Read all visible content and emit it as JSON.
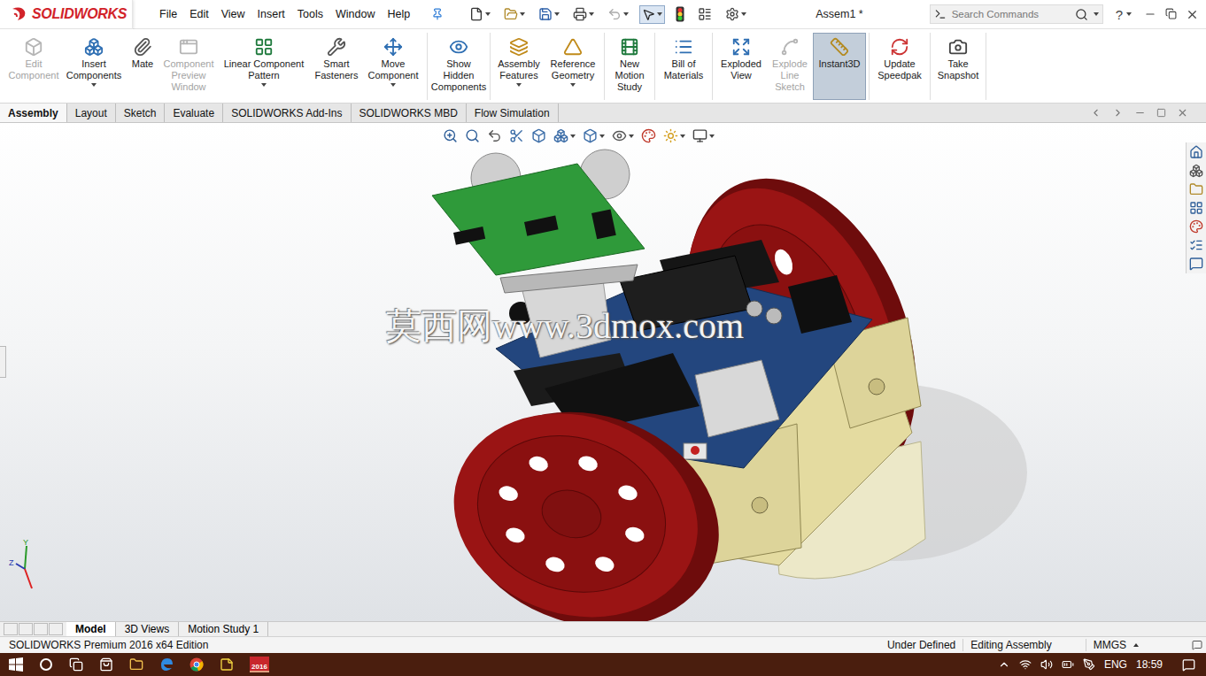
{
  "app": {
    "logo": "SOLIDWORKS"
  },
  "menu": [
    "File",
    "Edit",
    "View",
    "Insert",
    "Tools",
    "Window",
    "Help"
  ],
  "window": {
    "title": "Assem1 *"
  },
  "search": {
    "placeholder": "Search Commands"
  },
  "help": "?",
  "ribbon_groups": [
    [
      {
        "label": "Edit Component",
        "disabled": true,
        "selected": false,
        "dropdown": false
      },
      {
        "label": "Insert Components",
        "disabled": false,
        "selected": false,
        "dropdown": true
      },
      {
        "label": "Mate",
        "disabled": false,
        "selected": false,
        "dropdown": false
      },
      {
        "label": "Component Preview Window",
        "disabled": true,
        "selected": false,
        "dropdown": false
      },
      {
        "label": "Linear Component Pattern",
        "disabled": false,
        "selected": false,
        "dropdown": true
      },
      {
        "label": "Smart Fasteners",
        "disabled": false,
        "selected": false,
        "dropdown": false
      },
      {
        "label": "Move Component",
        "disabled": false,
        "selected": false,
        "dropdown": true
      }
    ],
    [
      {
        "label": "Show Hidden Components",
        "disabled": false,
        "selected": false,
        "dropdown": false
      }
    ],
    [
      {
        "label": "Assembly Features",
        "disabled": false,
        "selected": false,
        "dropdown": true
      },
      {
        "label": "Reference Geometry",
        "disabled": false,
        "selected": false,
        "dropdown": true
      }
    ],
    [
      {
        "label": "New Motion Study",
        "disabled": false,
        "selected": false,
        "dropdown": false
      }
    ],
    [
      {
        "label": "Bill of Materials",
        "disabled": false,
        "selected": false,
        "dropdown": false
      }
    ],
    [
      {
        "label": "Exploded View",
        "disabled": false,
        "selected": false,
        "dropdown": false
      },
      {
        "label": "Explode Line Sketch",
        "disabled": true,
        "selected": false,
        "dropdown": false
      },
      {
        "label": "Instant3D",
        "disabled": false,
        "selected": true,
        "dropdown": false
      }
    ],
    [
      {
        "label": "Update Speedpak",
        "disabled": false,
        "selected": false,
        "dropdown": false
      }
    ],
    [
      {
        "label": "Take Snapshot",
        "disabled": false,
        "selected": false,
        "dropdown": false
      }
    ]
  ],
  "tabs": [
    {
      "label": "Assembly",
      "selected": true
    },
    {
      "label": "Layout",
      "selected": false
    },
    {
      "label": "Sketch",
      "selected": false
    },
    {
      "label": "Evaluate",
      "selected": false
    },
    {
      "label": "SOLIDWORKS Add-Ins",
      "selected": false
    },
    {
      "label": "SOLIDWORKS MBD",
      "selected": false
    },
    {
      "label": "Flow Simulation",
      "selected": false
    }
  ],
  "viewport": {
    "watermark": "莫西网www.3dmox.com",
    "triad": [
      "Y",
      "Z"
    ]
  },
  "model_tabs": [
    {
      "label": "Model",
      "selected": true
    },
    {
      "label": "3D Views",
      "selected": false
    },
    {
      "label": "Motion Study 1",
      "selected": false
    }
  ],
  "status_bar": {
    "edition": "SOLIDWORKS Premium 2016 x64 Edition",
    "state": "Under Defined",
    "mode": "Editing Assembly",
    "units": "MMGS"
  },
  "taskbar": {
    "app_badge": "2016",
    "language": "ENG",
    "time": "18:59"
  }
}
